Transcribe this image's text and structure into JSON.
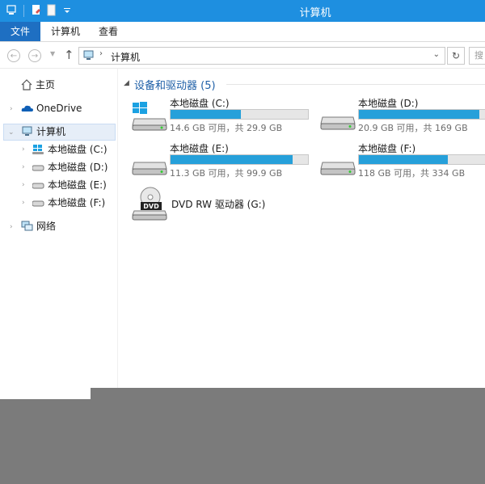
{
  "window": {
    "title": "计算机"
  },
  "ribbon": {
    "tabs": [
      "文件",
      "计算机",
      "查看"
    ]
  },
  "address": {
    "path": "计算机",
    "search_placeholder": "搜"
  },
  "navpane": {
    "items": [
      {
        "label": "主页",
        "icon": "home-icon"
      },
      {
        "label": "OneDrive",
        "icon": "onedrive-cloud-icon"
      },
      {
        "label": "计算机",
        "icon": "computer-icon"
      },
      {
        "label": "本地磁盘 (C:)",
        "icon": "windows-drive-icon"
      },
      {
        "label": "本地磁盘 (D:)",
        "icon": "drive-icon"
      },
      {
        "label": "本地磁盘 (E:)",
        "icon": "drive-icon"
      },
      {
        "label": "本地磁盘 (F:)",
        "icon": "drive-icon"
      },
      {
        "label": "网络",
        "icon": "network-icon"
      }
    ]
  },
  "content": {
    "group_title": "设备和驱动器 (5)",
    "drives": [
      {
        "name": "本地磁盘 (C:)",
        "free_text": "14.6 GB 可用，共 29.9 GB",
        "used_fraction": 0.512
      },
      {
        "name": "本地磁盘 (D:)",
        "free_text": "20.9 GB 可用，共 169 GB",
        "used_fraction": 0.876
      },
      {
        "name": "本地磁盘 (E:)",
        "free_text": "11.3 GB 可用，共 99.9 GB",
        "used_fraction": 0.887
      },
      {
        "name": "本地磁盘 (F:)",
        "free_text": "118 GB 可用，共 334 GB",
        "used_fraction": 0.647
      }
    ],
    "dvd": {
      "name": "DVD RW 驱动器 (G:)",
      "badge": "DVD"
    }
  },
  "colors": {
    "titlebar": "#1e8fe0",
    "file_tab": "#1e6fc2",
    "bar_fill": "#26a0da",
    "group_header": "#1e5fa7"
  }
}
